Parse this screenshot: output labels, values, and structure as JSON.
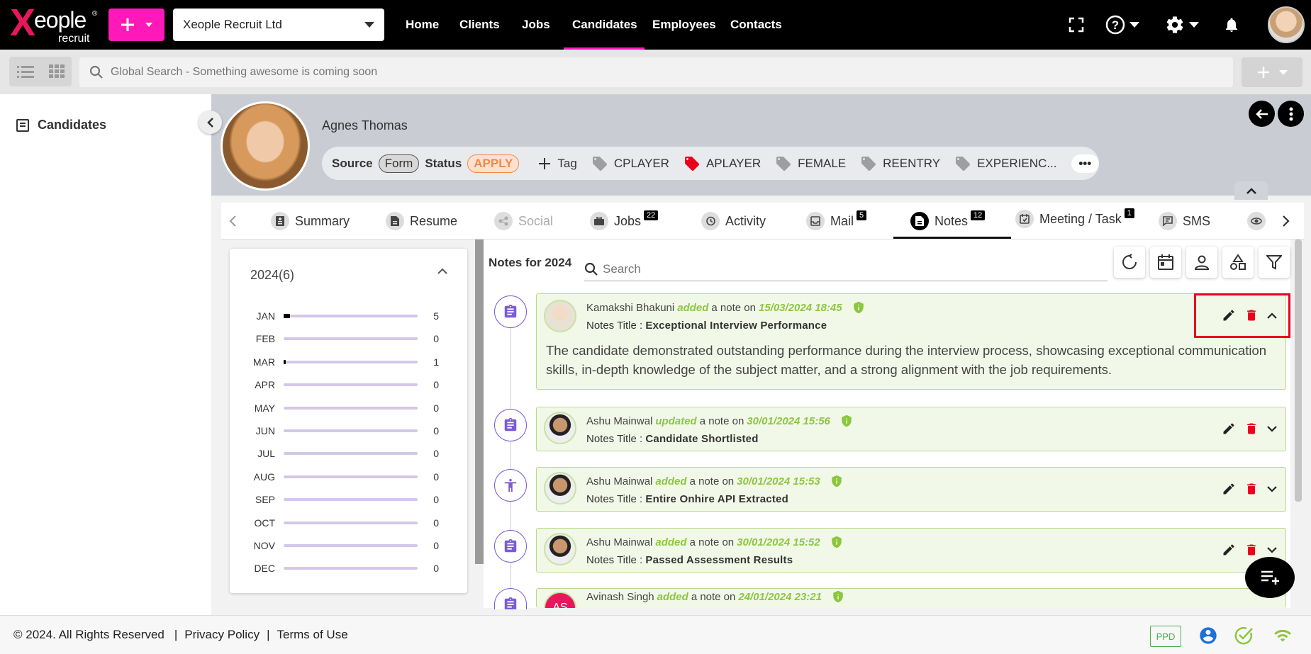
{
  "brand": {
    "name": "Xeople",
    "x": "X",
    "rest": "eople",
    "reg": "®",
    "sub": "recruit"
  },
  "company": {
    "value": "Xeople Recruit Ltd"
  },
  "nav": [
    "Home",
    "Clients",
    "Jobs",
    "Candidates",
    "Employees",
    "Contacts"
  ],
  "active_nav": "Candidates",
  "search": {
    "placeholder": "Global Search - Something awesome is coming soon"
  },
  "sidebar": {
    "label": "Candidates"
  },
  "candidate": {
    "name": "Agnes Thomas",
    "source_label": "Source",
    "source_value": "Form",
    "status_label": "Status",
    "status_value": "APPLY",
    "add_tag_label": "Tag",
    "tags": [
      {
        "label": "CPLAYER",
        "color": "#9e9e9e"
      },
      {
        "label": "APLAYER",
        "color": "#e8001d"
      },
      {
        "label": "FEMALE",
        "color": "#9e9e9e"
      },
      {
        "label": "REENTRY",
        "color": "#9e9e9e"
      },
      {
        "label": "EXPERIENC...",
        "color": "#9e9e9e"
      }
    ],
    "more_label": "•••"
  },
  "tabs": [
    {
      "label": "Summary"
    },
    {
      "label": "Resume"
    },
    {
      "label": "Social"
    },
    {
      "label": "Jobs",
      "badge": "22"
    },
    {
      "label": "Activity"
    },
    {
      "label": "Mail",
      "badge": "5"
    },
    {
      "label": "Notes",
      "badge": "12"
    },
    {
      "label": "Meeting / Task",
      "badge": "1"
    },
    {
      "label": "SMS"
    }
  ],
  "calendar": {
    "year_label": "2024(6)",
    "months": [
      {
        "m": "JAN",
        "v": "5",
        "frac": 0.05
      },
      {
        "m": "FEB",
        "v": "0",
        "frac": 0
      },
      {
        "m": "MAR",
        "v": "1",
        "frac": 0.01
      },
      {
        "m": "APR",
        "v": "0",
        "frac": 0
      },
      {
        "m": "MAY",
        "v": "0",
        "frac": 0
      },
      {
        "m": "JUN",
        "v": "0",
        "frac": 0
      },
      {
        "m": "JUL",
        "v": "0",
        "frac": 0
      },
      {
        "m": "AUG",
        "v": "0",
        "frac": 0
      },
      {
        "m": "SEP",
        "v": "0",
        "frac": 0
      },
      {
        "m": "OCT",
        "v": "0",
        "frac": 0
      },
      {
        "m": "NOV",
        "v": "0",
        "frac": 0
      },
      {
        "m": "DEC",
        "v": "0",
        "frac": 0
      }
    ]
  },
  "notes": {
    "heading": "Notes for 2024",
    "search_placeholder": "Search",
    "title_prefix": "Notes Title :",
    "a_note_on": "a note on",
    "items": [
      {
        "author": "Kamakshi Bhakuni",
        "action": "added",
        "date": "15/03/2024 18:45",
        "title": "Exceptional Interview Performance",
        "body": "The candidate demonstrated outstanding performance during the interview process, showcasing exceptional communication skills, in-depth knowledge of the subject matter, and a strong alignment with the job requirements."
      },
      {
        "author": "Ashu Mainwal",
        "action": "updated",
        "date": "30/01/2024 15:56",
        "title": "Candidate Shortlisted"
      },
      {
        "author": "Ashu Mainwal",
        "action": "added",
        "date": "30/01/2024 15:53",
        "title": "Entire Onhire API Extracted"
      },
      {
        "author": "Ashu Mainwal",
        "action": "added",
        "date": "30/01/2024 15:52",
        "title": "Passed Assessment Results"
      },
      {
        "author": "Avinash Singh",
        "action": "added",
        "date": "24/01/2024 23:21",
        "initials": "AS"
      }
    ]
  },
  "footer": {
    "copyright": "© 2024. All Rights Reserved",
    "sep": "|",
    "privacy": "Privacy Policy",
    "terms": "Terms of Use",
    "ppd": "PPD"
  },
  "colors": {
    "accent": "#ff19b8",
    "green": "#8cc63f",
    "purple": "#7c5cd6",
    "delete": "#e8001d"
  }
}
